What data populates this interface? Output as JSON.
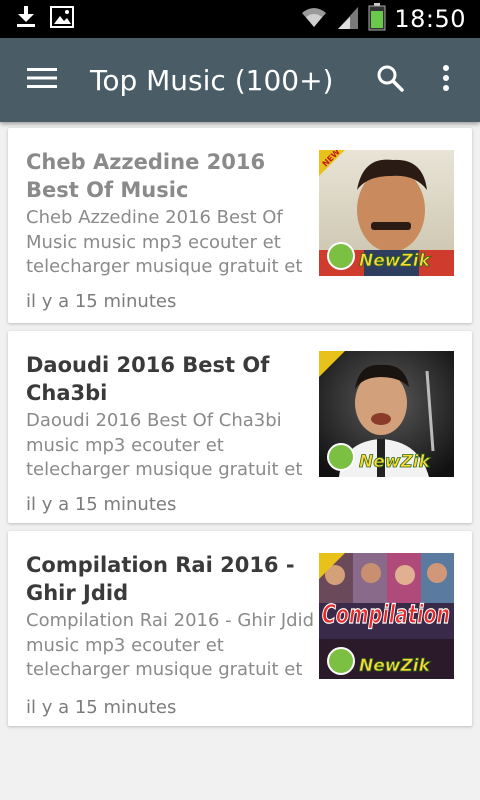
{
  "status_bar": {
    "time": "18:50",
    "left_icons": [
      "download-icon",
      "image-icon"
    ],
    "right_icons": [
      "wifi-icon",
      "signal-icon",
      "battery-icon"
    ],
    "battery_color": "#6ac84a"
  },
  "app_bar": {
    "title": "Top Music (100+)",
    "background": "#4a5d66",
    "icons": [
      "menu-icon",
      "search-icon",
      "more-vert-icon"
    ]
  },
  "items": [
    {
      "title": "Cheb Azzedine 2016 Best Of Music",
      "description": "Cheb Azzedine 2016 Best Of Music music mp3 ecouter et telecharger musique gratuit et",
      "time": "il y a 15 minutes",
      "thumbnail_badge": "NewZik",
      "thumbnail_ribbon": "NEW"
    },
    {
      "title": "Daoudi 2016 Best Of Cha3bi",
      "description": "Daoudi 2016 Best Of Cha3bi music mp3 ecouter et telecharger musique gratuit et",
      "time": "il y a 15 minutes",
      "thumbnail_badge": "NewZik",
      "thumbnail_ribbon": "NEW"
    },
    {
      "title": "Compilation Rai 2016 - Ghir Jdid",
      "description": "Compilation Rai 2016 - Ghir Jdid music mp3 ecouter et telecharger musique gratuit et",
      "time": "il y a 15 minutes",
      "thumbnail_badge": "NewZik",
      "thumbnail_ribbon": "NEW",
      "thumbnail_caption": "Compilation"
    }
  ]
}
